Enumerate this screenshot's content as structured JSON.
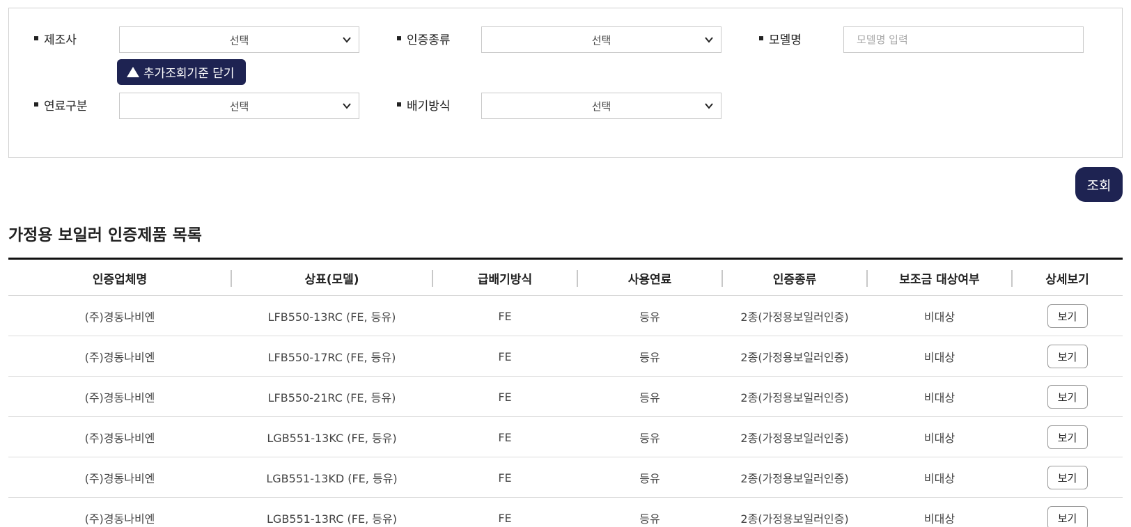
{
  "filters": {
    "manufacturer": {
      "label": "제조사",
      "value": "선택"
    },
    "cert_type": {
      "label": "인증종류",
      "value": "선택"
    },
    "model_name": {
      "label": "모델명",
      "placeholder": "모델명 입력"
    },
    "fuel": {
      "label": "연료구분",
      "value": "선택"
    },
    "exhaust": {
      "label": "배기방식",
      "value": "선택"
    },
    "toggle_label": "추가조회기준 닫기",
    "search_label": "조회"
  },
  "list": {
    "title": "가정용 보일러 인증제품 목록",
    "columns": [
      "인증업체명",
      "상표(모델)",
      "급배기방식",
      "사용연료",
      "인증종류",
      "보조금 대상여부",
      "상세보기"
    ],
    "rows": [
      [
        "(주)경동나비엔",
        "LFB550-13RC (FE, 등유)",
        "FE",
        "등유",
        "2종(가정용보일러인증)",
        "비대상",
        "보기"
      ],
      [
        "(주)경동나비엔",
        "LFB550-17RC (FE, 등유)",
        "FE",
        "등유",
        "2종(가정용보일러인증)",
        "비대상",
        "보기"
      ],
      [
        "(주)경동나비엔",
        "LFB550-21RC (FE, 등유)",
        "FE",
        "등유",
        "2종(가정용보일러인증)",
        "비대상",
        "보기"
      ],
      [
        "(주)경동나비엔",
        "LGB551-13KC (FE, 등유)",
        "FE",
        "등유",
        "2종(가정용보일러인증)",
        "비대상",
        "보기"
      ],
      [
        "(주)경동나비엔",
        "LGB551-13KD (FE, 등유)",
        "FE",
        "등유",
        "2종(가정용보일러인증)",
        "비대상",
        "보기"
      ],
      [
        "(주)경동나비엔",
        "LGB551-13RC (FE, 등유)",
        "FE",
        "등유",
        "2종(가정용보일러인증)",
        "비대상",
        "보기"
      ]
    ]
  },
  "colors": {
    "accent": "#1e2352"
  }
}
